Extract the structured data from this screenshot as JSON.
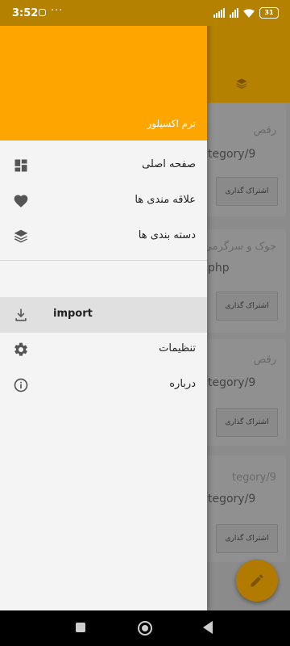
{
  "status_bar": {
    "time": "3:52",
    "more": "···",
    "battery": "31"
  },
  "drawer": {
    "app_name": "ترم اکسپلور",
    "items": [
      {
        "label": "صفحه اصلی",
        "icon": "dashboard-icon"
      },
      {
        "label": "علاقه مندی ها",
        "icon": "heart-icon"
      },
      {
        "label": "دسته بندی ها",
        "icon": "layers-icon"
      },
      {
        "label": "import",
        "icon": "download-icon",
        "selected": true
      },
      {
        "label": "تنظیمات",
        "icon": "gear-icon"
      },
      {
        "label": "درباره",
        "icon": "info-icon"
      }
    ]
  },
  "background_list": {
    "cards": [
      {
        "category": "رقص",
        "path": "tegory/9",
        "share": "اشتراک گذاری"
      },
      {
        "category": "جوک و سرگرمی",
        "path": "php",
        "share": "اشتراک گذاری"
      },
      {
        "category": "رقص",
        "path": "tegory/9",
        "share": "اشتراک گذاری"
      },
      {
        "category": "tegory/9",
        "path": "tegory/9",
        "share": "اشتراک گذاری"
      }
    ]
  },
  "colors": {
    "accent": "#ffa500",
    "status_bar": "#b58100",
    "drawer_bg": "#f4f4f4"
  }
}
